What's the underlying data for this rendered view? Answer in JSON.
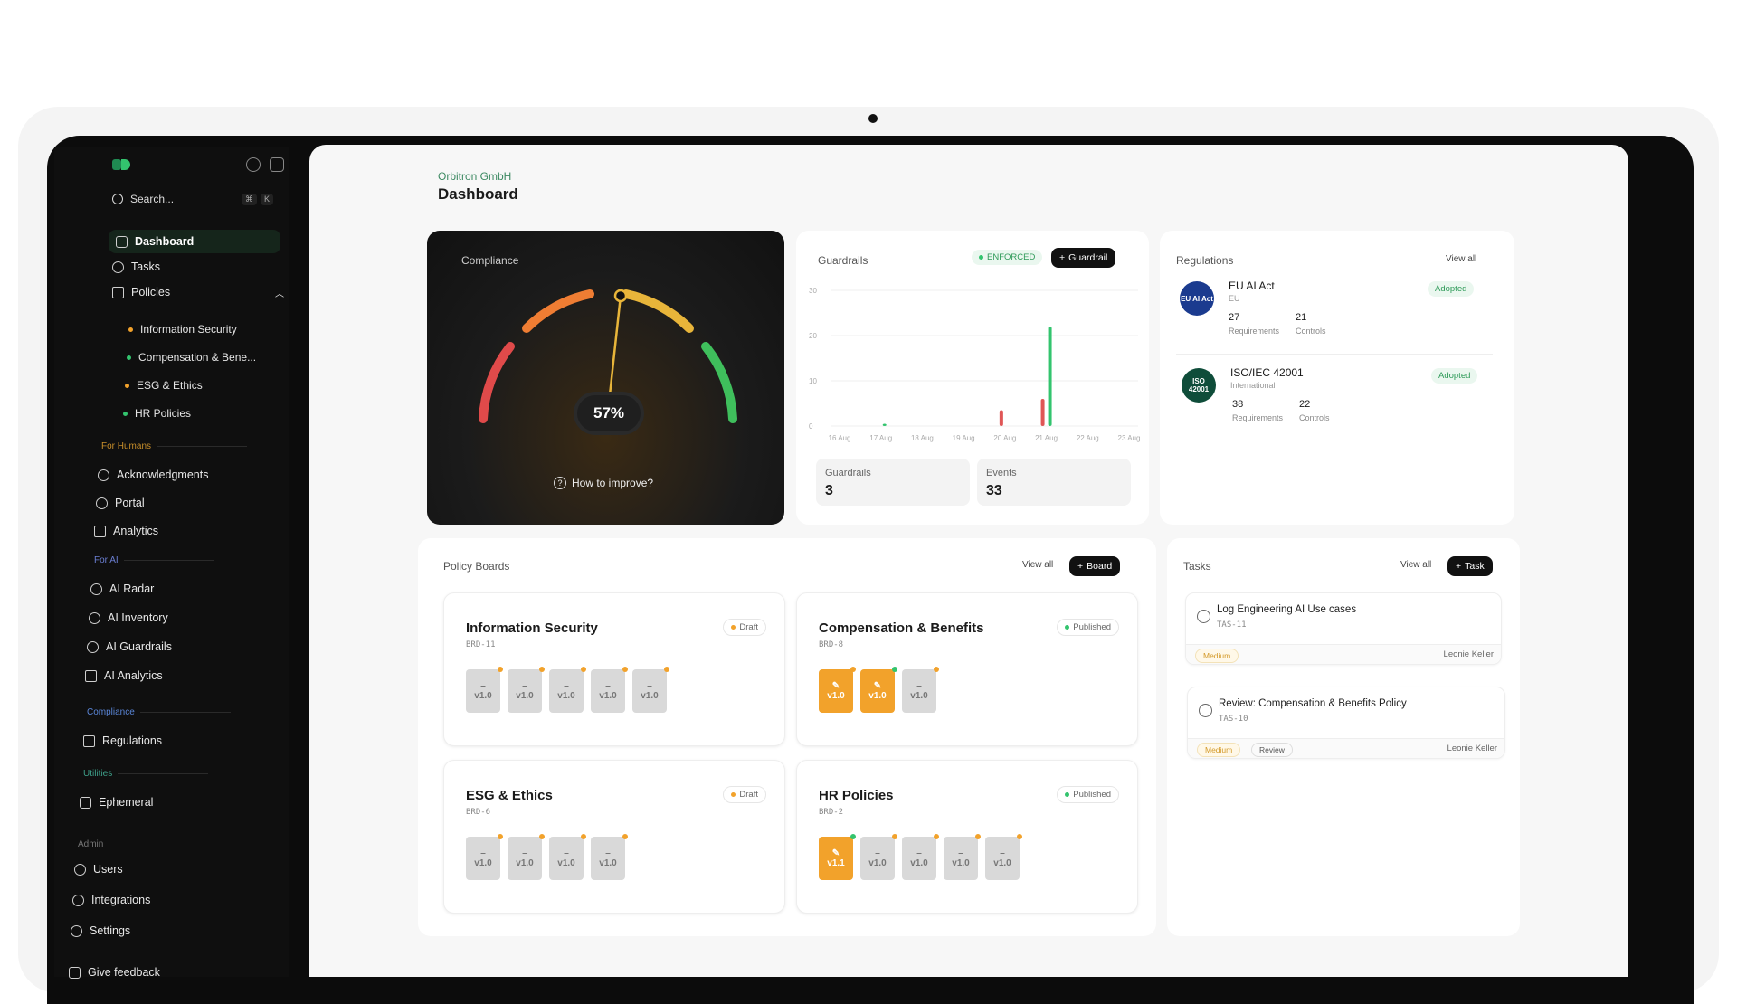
{
  "sidebar": {
    "search_placeholder": "Search...",
    "kbd": [
      "⌘",
      "K"
    ],
    "nav": {
      "dashboard": "Dashboard",
      "tasks": "Tasks",
      "policies": "Policies"
    },
    "policies": [
      {
        "label": "Information Security",
        "color": "#f2a22b"
      },
      {
        "label": "Compensation & Bene...",
        "color": "#33c46e"
      },
      {
        "label": "ESG & Ethics",
        "color": "#f2a22b"
      },
      {
        "label": "HR Policies",
        "color": "#33c46e"
      }
    ],
    "sections": {
      "humans": "For Humans",
      "ai": "For AI",
      "compliance": "Compliance",
      "utilities": "Utilities",
      "admin": "Admin"
    },
    "humans_items": [
      "Acknowledgments",
      "Portal",
      "Analytics"
    ],
    "ai_items": [
      "AI Radar",
      "AI Inventory",
      "AI Guardrails",
      "AI Analytics"
    ],
    "compliance_items": [
      "Regulations"
    ],
    "utilities_items": [
      "Ephemeral"
    ],
    "admin_items": [
      "Users",
      "Integrations",
      "Settings"
    ],
    "feedback": "Give feedback"
  },
  "header": {
    "company": "Orbitron GmbH",
    "title": "Dashboard"
  },
  "compliance": {
    "label": "Compliance",
    "value": "57%",
    "value_fraction": 0.57,
    "improve": "How to improve?"
  },
  "guardrails": {
    "title": "Guardrails",
    "status": "ENFORCED",
    "add_button": "Guardrail",
    "stats": [
      {
        "label": "Guardrails",
        "value": "3"
      },
      {
        "label": "Events",
        "value": "33"
      }
    ]
  },
  "chart_data": {
    "type": "bar",
    "categories": [
      "16 Aug",
      "17 Aug",
      "18 Aug",
      "19 Aug",
      "20 Aug",
      "21 Aug",
      "22 Aug",
      "23 Aug"
    ],
    "yticks": [
      0,
      10,
      20,
      30
    ],
    "ylim": [
      0,
      30
    ],
    "series": [
      {
        "color": "#33c46e",
        "values": [
          0,
          0.5,
          0,
          0,
          0,
          22,
          0,
          0
        ]
      },
      {
        "color": "#e05656",
        "values": [
          0,
          0,
          0,
          0,
          3.5,
          6,
          0,
          0
        ]
      }
    ],
    "grid": true
  },
  "regulations": {
    "title": "Regulations",
    "view_all": "View all",
    "items": [
      {
        "name": "EU AI Act",
        "region": "EU",
        "badge": "EU AI Act",
        "status": "Adopted",
        "requirements": "27",
        "controls": "21",
        "req_label": "Requirements",
        "ctrl_label": "Controls"
      },
      {
        "name": "ISO/IEC 42001",
        "region": "International",
        "badge": "ISO 42001",
        "status": "Adopted",
        "requirements": "38",
        "controls": "22",
        "req_label": "Requirements",
        "ctrl_label": "Controls"
      }
    ]
  },
  "boards": {
    "title": "Policy Boards",
    "view_all": "View all",
    "add_button": "Board",
    "items": [
      {
        "title": "Information Security",
        "id": "BRD-11",
        "status": "Draft",
        "status_color": "#f2a22b"
      },
      {
        "title": "Compensation & Benefits",
        "id": "BRD-8",
        "status": "Published",
        "status_color": "#33c46e"
      },
      {
        "title": "ESG & Ethics",
        "id": "BRD-6",
        "status": "Draft",
        "status_color": "#f2a22b"
      },
      {
        "title": "HR Policies",
        "id": "BRD-2",
        "status": "Published",
        "status_color": "#33c46e"
      }
    ],
    "version_dash": "–",
    "v10": "v1.0",
    "v11": "v1.1"
  },
  "tasks": {
    "title": "Tasks",
    "view_all": "View all",
    "add_button": "Task",
    "items": [
      {
        "title": "Log Engineering AI Use cases",
        "id": "TAS-11",
        "priority": "Medium",
        "assignee": "Leonie Keller"
      },
      {
        "title": "Review: Compensation & Benefits Policy",
        "id": "TAS-10",
        "priority": "Medium",
        "tag2": "Review",
        "assignee": "Leonie Keller"
      }
    ]
  }
}
